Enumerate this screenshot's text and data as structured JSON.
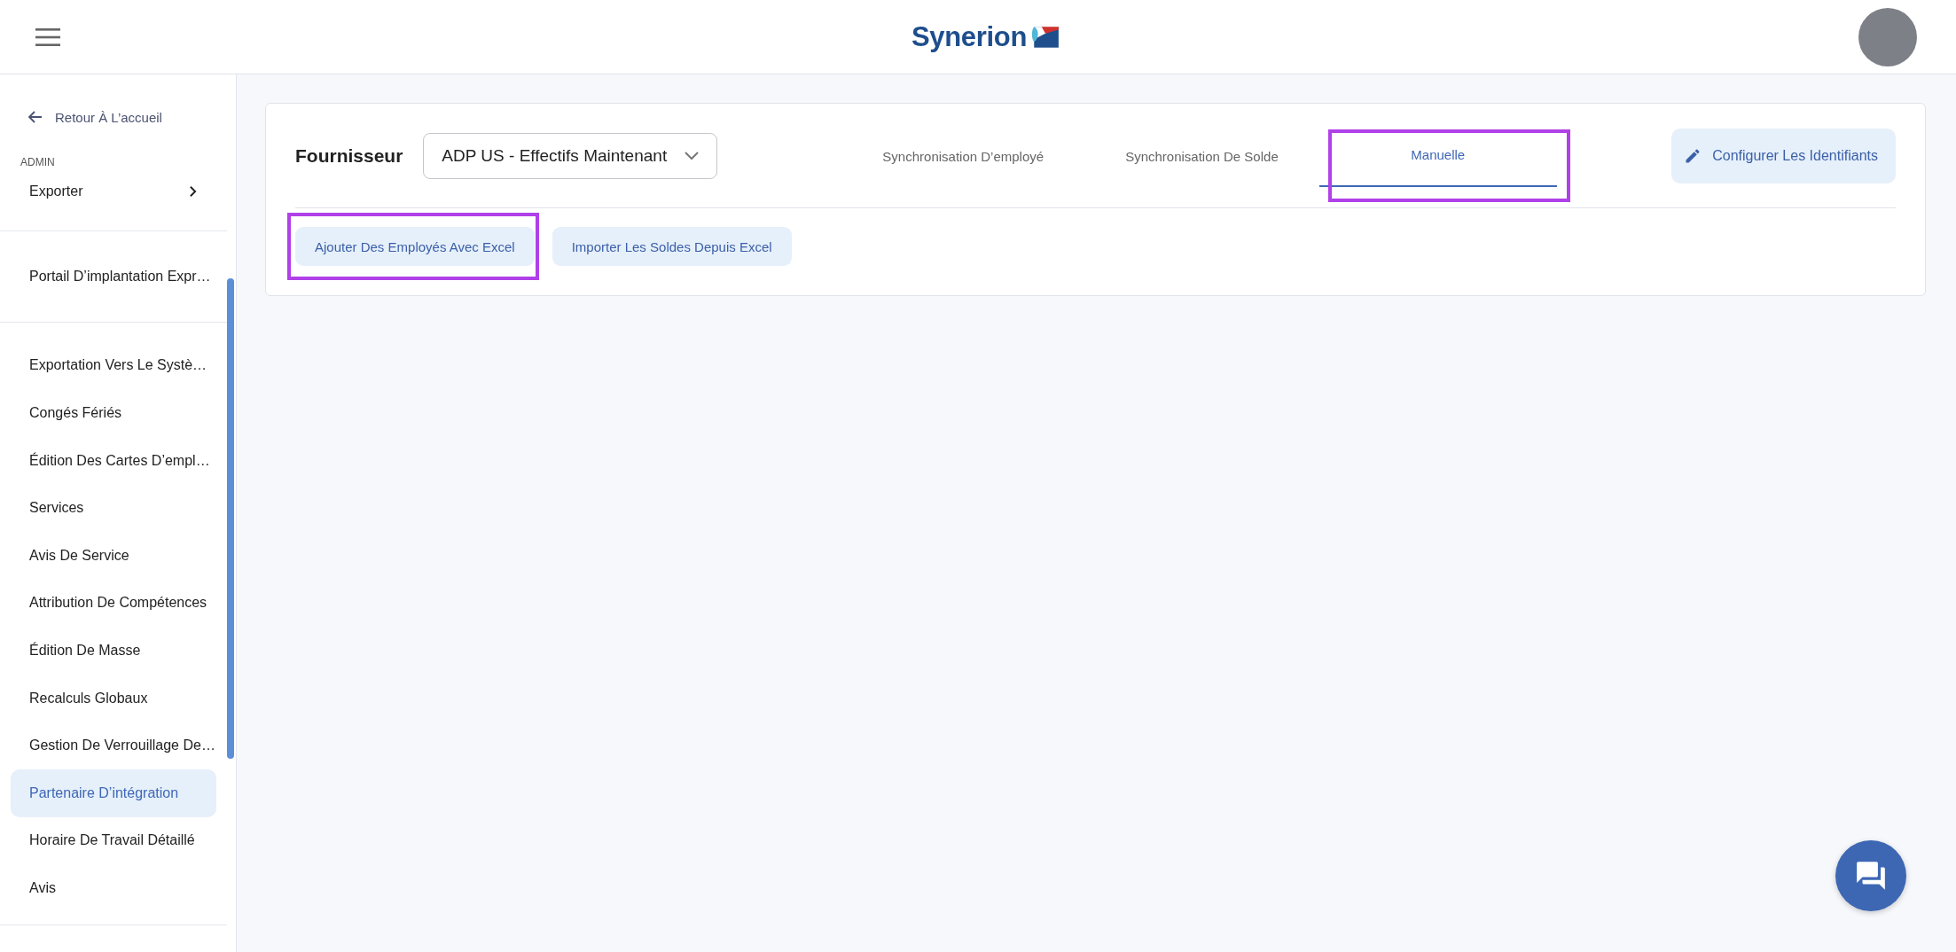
{
  "header": {
    "logo_text": "Synerion"
  },
  "sidebar": {
    "back": "Retour À L’accueil",
    "section": "ADMIN",
    "groups": [
      [
        {
          "label": "Exporter",
          "kind": "submenu",
          "selected": false
        }
      ],
      [
        {
          "label": "Portail D’implantation Expr…",
          "kind": "link",
          "selected": false
        }
      ],
      [
        {
          "label": "Exportation Vers Le Systè…",
          "kind": "link",
          "selected": false
        },
        {
          "label": "Congés Fériés",
          "kind": "link",
          "selected": false
        },
        {
          "label": "Édition Des Cartes D’empl…",
          "kind": "link",
          "selected": false
        },
        {
          "label": "Services",
          "kind": "link",
          "selected": false
        },
        {
          "label": "Avis De Service",
          "kind": "link",
          "selected": false
        },
        {
          "label": "Attribution De Compétences",
          "kind": "link",
          "selected": false
        },
        {
          "label": "Édition De Masse",
          "kind": "link",
          "selected": false
        },
        {
          "label": "Recalculs Globaux",
          "kind": "link",
          "selected": false
        },
        {
          "label": "Gestion De Verrouillage De…",
          "kind": "link",
          "selected": false
        },
        {
          "label": "Partenaire D’intégration",
          "kind": "link",
          "selected": true
        },
        {
          "label": "Horaire De Travail Détaillé",
          "kind": "link",
          "selected": false
        },
        {
          "label": "Avis",
          "kind": "link",
          "selected": false
        }
      ]
    ]
  },
  "toolbar": {
    "provider_label": "Fournisseur",
    "provider_value": "ADP US - Effectifs Maintenant",
    "tabs": [
      {
        "label": "Synchronisation D’employé",
        "selected": false,
        "highlighted": false
      },
      {
        "label": "Synchronisation De Solde",
        "selected": false,
        "highlighted": false
      },
      {
        "label": "Manuelle",
        "selected": true,
        "highlighted": true
      }
    ],
    "configure_button": "Configurer Les Identifiants"
  },
  "actions": [
    {
      "label": "Ajouter Des Employés Avec Excel",
      "highlighted": true
    },
    {
      "label": "Importer Les Soldes Depuis Excel",
      "highlighted": false
    }
  ]
}
